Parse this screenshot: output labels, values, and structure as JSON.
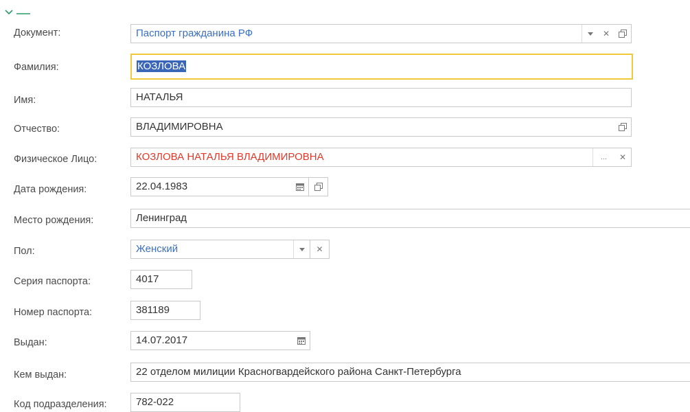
{
  "form": {
    "collapse_icon": "chevron-down-icon",
    "rows": {
      "document": {
        "label": "Документ:",
        "value": "Паспорт гражданина РФ"
      },
      "surname": {
        "label": "Фамилия:",
        "value": "КОЗЛОВА"
      },
      "name": {
        "label": "Имя:",
        "value": "НАТАЛЬЯ"
      },
      "patronymic": {
        "label": "Отчество:",
        "value": "ВЛАДИМИРОВНА"
      },
      "person": {
        "label": "Физическое Лицо:",
        "value": "КОЗЛОВА НАТАЛЬЯ ВЛАДИМИРОВНА",
        "more": "..."
      },
      "birth_date": {
        "label": "Дата рождения:",
        "value": "22.04.1983"
      },
      "birth_place": {
        "label": "Место рождения:",
        "value": "Ленинград"
      },
      "gender": {
        "label": "Пол:",
        "value": "Женский"
      },
      "series": {
        "label": "Серия паспорта:",
        "value": "4017"
      },
      "number": {
        "label": "Номер паспорта:",
        "value": "381189"
      },
      "issued": {
        "label": "Выдан:",
        "value": "14.07.2017"
      },
      "issued_by": {
        "label": "Кем выдан:",
        "value": "22 отделом милиции Красногвардейского района Санкт-Петербурга"
      },
      "dept_code": {
        "label": "Код подразделения:",
        "value": "782-022"
      }
    }
  },
  "colors": {
    "link": "#3b6fbf",
    "error_red": "#e0392a",
    "focus_border": "#f0c838",
    "selection": "#3966b8",
    "accent_green": "#2a9a6a"
  }
}
